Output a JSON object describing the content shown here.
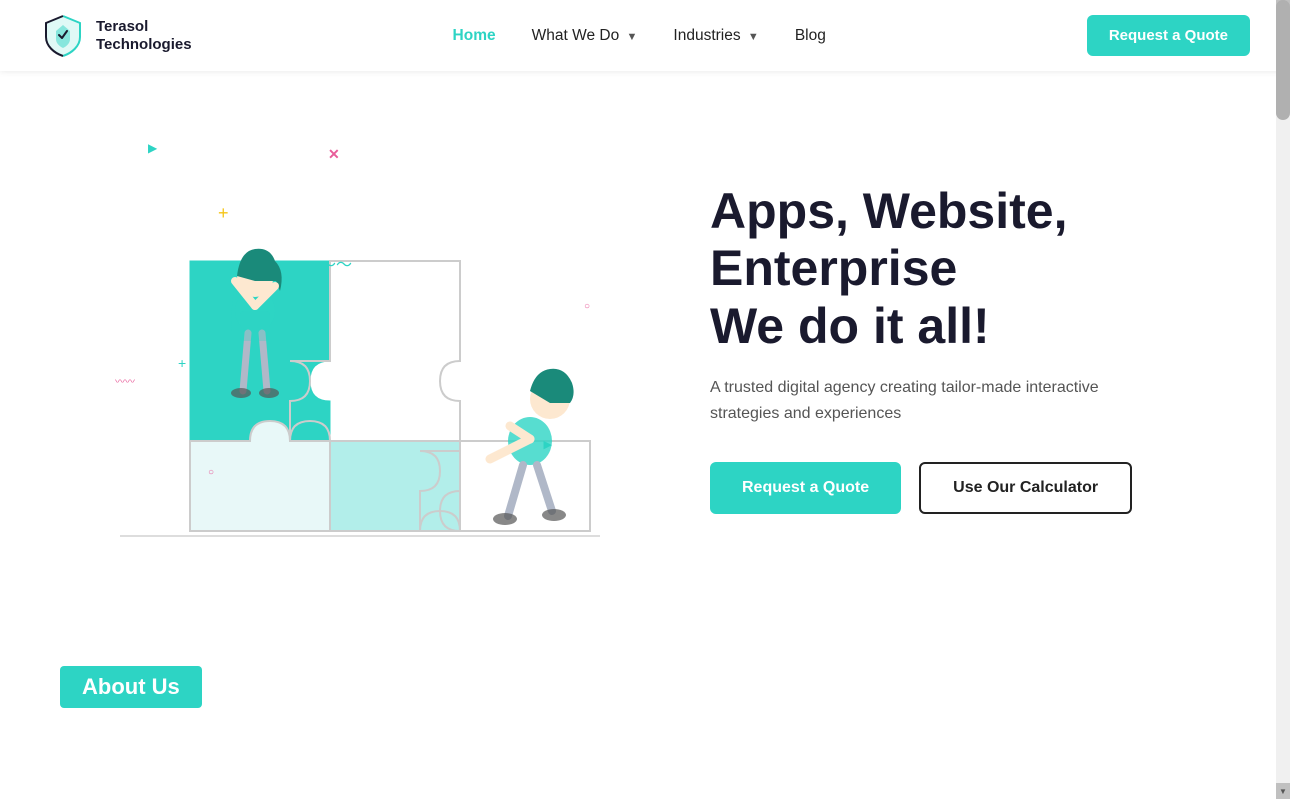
{
  "brand": {
    "name_line1": "Terasol",
    "name_line2": "Technologies"
  },
  "nav": {
    "home": "Home",
    "what_we_do": "What We Do",
    "industries": "Industries",
    "blog": "Blog",
    "request_quote": "Request a Quote"
  },
  "hero": {
    "title_line1": "Apps, Website,",
    "title_line2": "Enterprise",
    "title_line3": "We do it all!",
    "subtitle": "A trusted digital agency creating tailor-made interactive strategies and experiences",
    "btn_primary": "Request a Quote",
    "btn_secondary": "Use Our Calculator"
  },
  "about": {
    "label": "About Us"
  },
  "colors": {
    "primary": "#2dd4c4",
    "dark": "#1a1a2e",
    "text": "#555"
  }
}
